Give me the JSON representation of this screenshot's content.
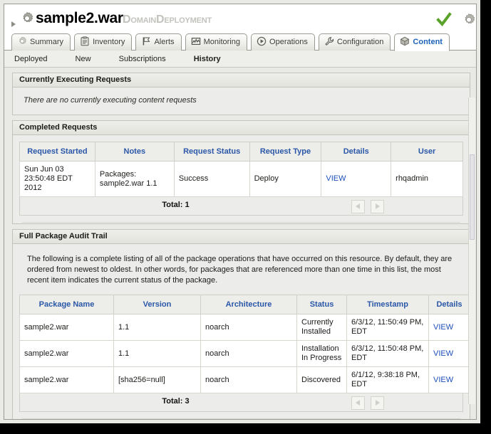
{
  "header": {
    "title": "sample2.war",
    "subtitle": "DomainDeployment",
    "expand_arrow_icon": "triangle-right-icon",
    "resource_icon": "gear-icon",
    "availability_icon": "green-check-icon",
    "corner_icon": "gear-icon"
  },
  "tabs": [
    {
      "label": "Summary",
      "icon": "gear-icon",
      "active": false
    },
    {
      "label": "Inventory",
      "icon": "clipboard-icon",
      "active": false
    },
    {
      "label": "Alerts",
      "icon": "flag-icon",
      "active": false
    },
    {
      "label": "Monitoring",
      "icon": "chart-icon",
      "active": false
    },
    {
      "label": "Operations",
      "icon": "play-icon",
      "active": false
    },
    {
      "label": "Configuration",
      "icon": "wrench-icon",
      "active": false
    },
    {
      "label": "Content",
      "icon": "box-icon",
      "active": true
    }
  ],
  "subnav": [
    {
      "label": "Deployed",
      "active": false
    },
    {
      "label": "New",
      "active": false
    },
    {
      "label": "Subscriptions",
      "active": false
    },
    {
      "label": "History",
      "active": true
    }
  ],
  "currently_executing": {
    "header": "Currently Executing Requests",
    "empty_message": "There are no currently executing content requests"
  },
  "completed_requests": {
    "header": "Completed Requests",
    "columns": [
      "Request Started",
      "Notes",
      "Request Status",
      "Request Type",
      "Details",
      "User"
    ],
    "rows": [
      {
        "request_started": "Sun Jun 03 23:50:48 EDT 2012",
        "notes": "Packages: sample2.war 1.1",
        "request_status": "Success",
        "request_type": "Deploy",
        "details": "VIEW",
        "user": "rhqadmin"
      }
    ],
    "total_label": "Total: 1",
    "pager": {
      "prev_icon": "triangle-left-icon",
      "next_icon": "triangle-right-icon"
    }
  },
  "audit_trail": {
    "header": "Full Package Audit Trail",
    "description": "The following is a complete listing of all of the package operations that have occurred on this resource. By default, they are ordered from newest to oldest. In other words, for packages that are referenced more than one time in this list, the most recent item indicates the current status of the package.",
    "columns": [
      "Package Name",
      "Version",
      "Architecture",
      "Status",
      "Timestamp",
      "Details"
    ],
    "rows": [
      {
        "package_name": "sample2.war",
        "version": "1.1",
        "architecture": "noarch",
        "status": "Currently Installed",
        "timestamp": "6/3/12, 11:50:49 PM, EDT",
        "details": "VIEW"
      },
      {
        "package_name": "sample2.war",
        "version": "1.1",
        "architecture": "noarch",
        "status": "Installation In Progress",
        "timestamp": "6/3/12, 11:50:48 PM, EDT",
        "details": "VIEW"
      },
      {
        "package_name": "sample2.war",
        "version": "[sha256=null]",
        "architecture": "noarch",
        "status": "Discovered",
        "timestamp": "6/1/12, 9:38:18 PM, EDT",
        "details": "VIEW"
      }
    ],
    "total_label": "Total: 3",
    "pager": {
      "prev_icon": "triangle-left-icon",
      "next_icon": "triangle-right-icon"
    }
  },
  "colors": {
    "header_link": "#2a57a8",
    "active_tab_text": "#1c63b8",
    "link": "#1c4fbb",
    "availability_green": "#5aa32a",
    "panel_bg": "#ececea",
    "frame_bg": "#e9e9e6"
  }
}
